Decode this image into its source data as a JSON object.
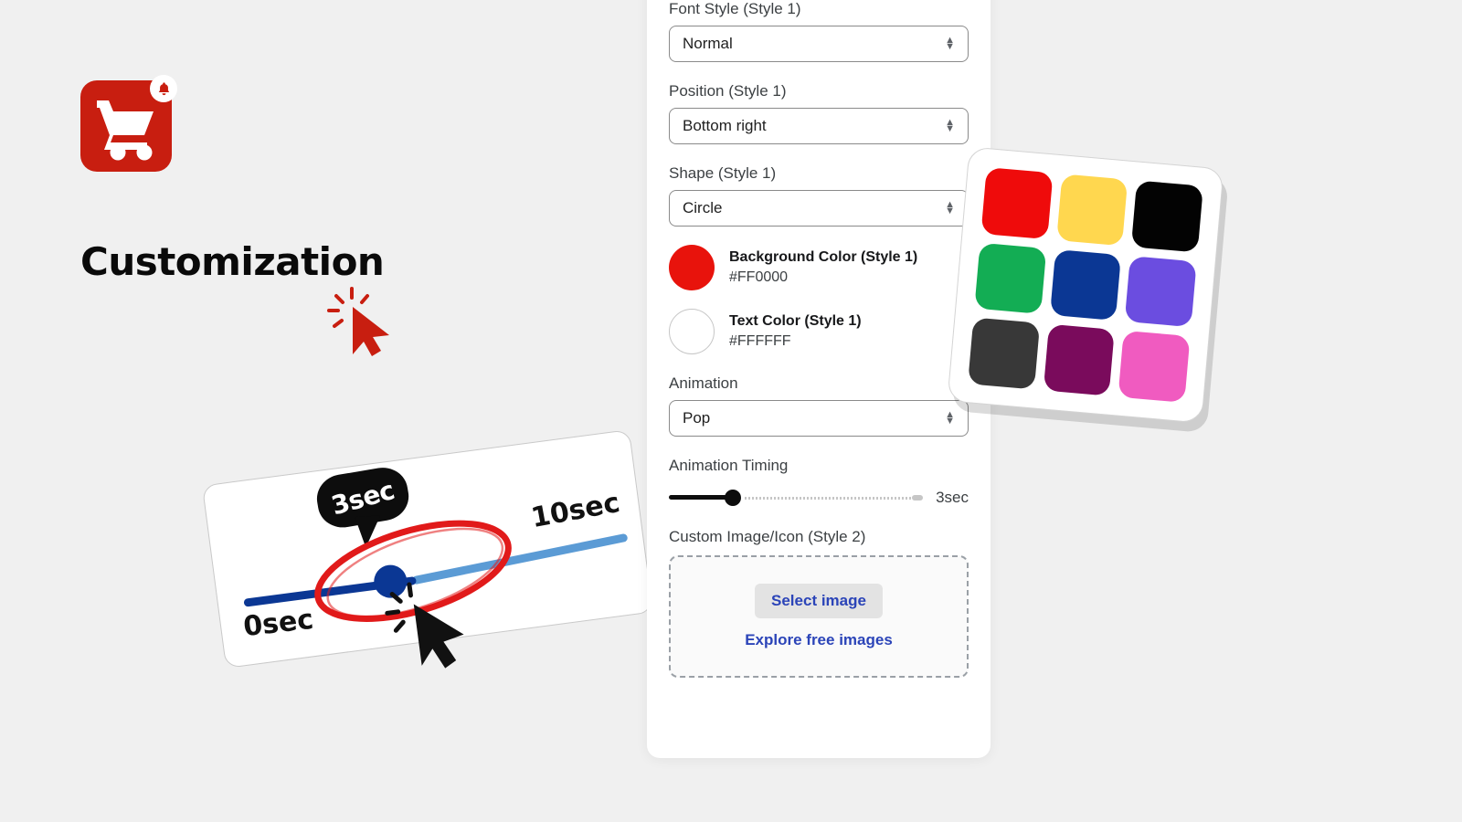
{
  "background_color": "#f0f0f0",
  "app_icon": {
    "name": "shopping-cart-notification-icon",
    "background_color": "#c81e10",
    "cart_color": "#ffffff",
    "badge_icon": "bell-icon",
    "badge_background": "#ffffff"
  },
  "page_title": "Customization",
  "red_cursor": {
    "name": "click-cursor-red",
    "color": "#c81e10"
  },
  "slider_card": {
    "label_left": "0sec",
    "label_right": "10sec",
    "bubble_value": "3sec",
    "fill_color": "#0b3794",
    "rest_color": "#5b9bd5",
    "thumb_color": "#0b3794",
    "annotation_color": "#e11a1a",
    "cursor_color": "#111111"
  },
  "settings": {
    "fields": [
      {
        "label": "Font Style (Style 1)",
        "value": "Normal",
        "name": "font-style-select"
      },
      {
        "label": "Position (Style 1)",
        "value": "Bottom right",
        "name": "position-select"
      },
      {
        "label": "Shape (Style 1)",
        "value": "Circle",
        "name": "shape-select"
      }
    ],
    "colors": [
      {
        "label": "Background Color (Style 1)",
        "hex": "#FF0000",
        "swatch": "#e8130c",
        "name": "background-color-row"
      },
      {
        "label": "Text Color (Style 1)",
        "hex": "#FFFFFF",
        "swatch": "#ffffff",
        "name": "text-color-row"
      }
    ],
    "animation": {
      "label": "Animation",
      "value": "Pop"
    },
    "animation_timing": {
      "label": "Animation Timing",
      "value": "3sec",
      "percent": 23
    },
    "custom_image": {
      "label": "Custom Image/Icon (Style 2)",
      "select_button": "Select image",
      "explore_link": "Explore free images"
    }
  },
  "palette": {
    "name": "color-palette-card",
    "swatches": [
      {
        "name": "swatch-red",
        "color": "#ef0b0b"
      },
      {
        "name": "swatch-yellow",
        "color": "#ffd74f"
      },
      {
        "name": "swatch-black",
        "color": "#030303"
      },
      {
        "name": "swatch-green",
        "color": "#13ad54"
      },
      {
        "name": "swatch-blue",
        "color": "#0b3794"
      },
      {
        "name": "swatch-violet",
        "color": "#6b4de0"
      },
      {
        "name": "swatch-dark-gray",
        "color": "#383838"
      },
      {
        "name": "swatch-purple",
        "color": "#7a0b5c"
      },
      {
        "name": "swatch-pink",
        "color": "#f05bc0"
      }
    ]
  }
}
